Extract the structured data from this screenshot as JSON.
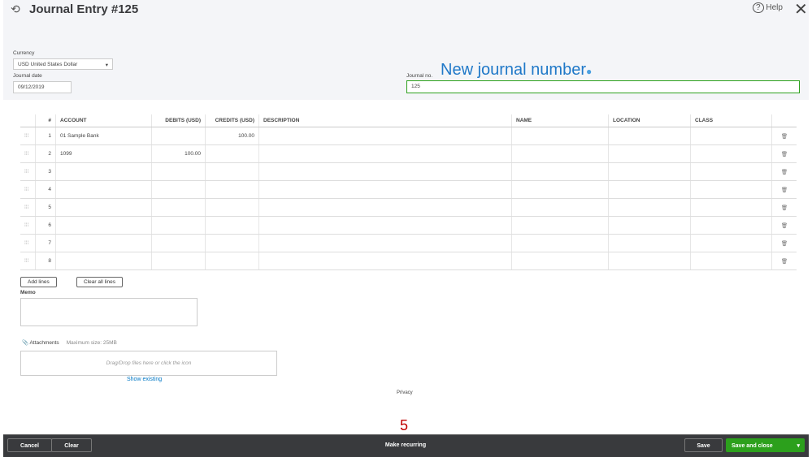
{
  "header": {
    "title": "Journal Entry #125",
    "help": "Help"
  },
  "form": {
    "currency_label": "Currency",
    "currency_value": "USD United States Dollar",
    "date_label": "Journal date",
    "date_value": "09/12/2019",
    "journal_no_label": "Journal no.",
    "journal_no_value": "125"
  },
  "annotation": {
    "text": "New journal number",
    "step": "5"
  },
  "table": {
    "headers": [
      "#",
      "ACCOUNT",
      "DEBITS (USD)",
      "CREDITS (USD)",
      "DESCRIPTION",
      "NAME",
      "LOCATION",
      "CLASS"
    ],
    "rows": [
      {
        "n": "1",
        "account": "01 Sample Bank",
        "debit": "",
        "credit": "100.00"
      },
      {
        "n": "2",
        "account": "1099",
        "debit": "100.00",
        "credit": ""
      },
      {
        "n": "3"
      },
      {
        "n": "4"
      },
      {
        "n": "5"
      },
      {
        "n": "6"
      },
      {
        "n": "7"
      },
      {
        "n": "8"
      }
    ]
  },
  "actions": {
    "add_lines": "Add lines",
    "clear_all": "Clear all lines"
  },
  "memo": {
    "label": "Memo"
  },
  "attachments": {
    "label": "Attachments",
    "max_size": "Maximum size: 25MB",
    "drop_text": "Drag/Drop files here or click the icon",
    "show_existing": "Show existing"
  },
  "privacy": "Privacy",
  "footer": {
    "cancel": "Cancel",
    "clear": "Clear",
    "make_recurring": "Make recurring",
    "save": "Save",
    "save_close": "Save and close"
  },
  "colors": {
    "green": "#2ca01c",
    "link": "#0077c5"
  }
}
